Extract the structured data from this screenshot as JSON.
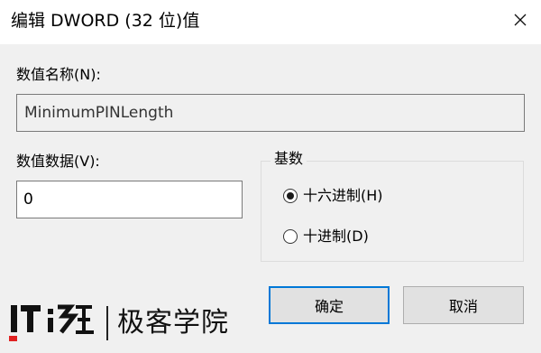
{
  "window": {
    "title": "编辑 DWORD (32 位)值",
    "close_icon": "close-icon"
  },
  "value_name": {
    "label": "数值名称(N):",
    "value": "MinimumPINLength"
  },
  "value_data": {
    "label": "数值数据(V):",
    "value": "0"
  },
  "base": {
    "legend": "基数",
    "options": [
      {
        "label": "十六进制(H)",
        "selected": true
      },
      {
        "label": "十进制(D)",
        "selected": false
      }
    ]
  },
  "buttons": {
    "ok_label": "确定",
    "cancel_label": "取消"
  },
  "watermark": {
    "logo_text": "IT之家",
    "text": "极客学院"
  },
  "colors": {
    "dialog_bg": "#f0f0f0",
    "titlebar_bg": "#ffffff",
    "focus_border": "#0078d7"
  }
}
